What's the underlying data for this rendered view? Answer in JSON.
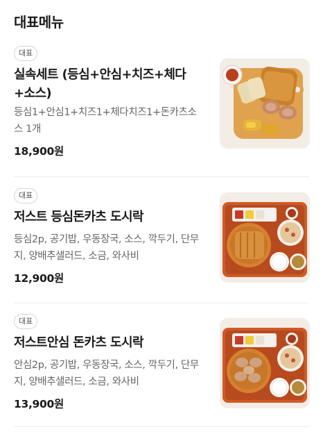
{
  "section": {
    "title": "대표메뉴"
  },
  "items": [
    {
      "badge": "대표",
      "name": "실속세트 (등심+안심+치즈+체다+소스)",
      "description": "등심1+안심1+치즈1+체다치즈1+돈카츠소스 1개",
      "price": "18,900원",
      "image_icon": "tonkatsu-set-photo"
    },
    {
      "badge": "대표",
      "name": "저스트 등심돈카츠 도시락",
      "description": "등심2p, 공기밥, 우동장국, 소스, 깍두기, 단무지, 양배추샐러드, 소금, 와사비",
      "price": "12,900원",
      "image_icon": "loin-tonkatsu-lunchbox-photo"
    },
    {
      "badge": "대표",
      "name": "저스트안심 돈카츠 도시락",
      "description": "안심2p, 공기밥, 우동장국, 소스, 깍두기, 단무지, 양배추샐러드, 소금, 와사비",
      "price": "13,900원",
      "image_icon": "tenderloin-tonkatsu-lunchbox-photo"
    }
  ],
  "colors": {
    "tray": "#d85c2a",
    "cutlet": "#d79235",
    "text_primary": "#1a1a1a",
    "text_secondary": "#666666"
  }
}
